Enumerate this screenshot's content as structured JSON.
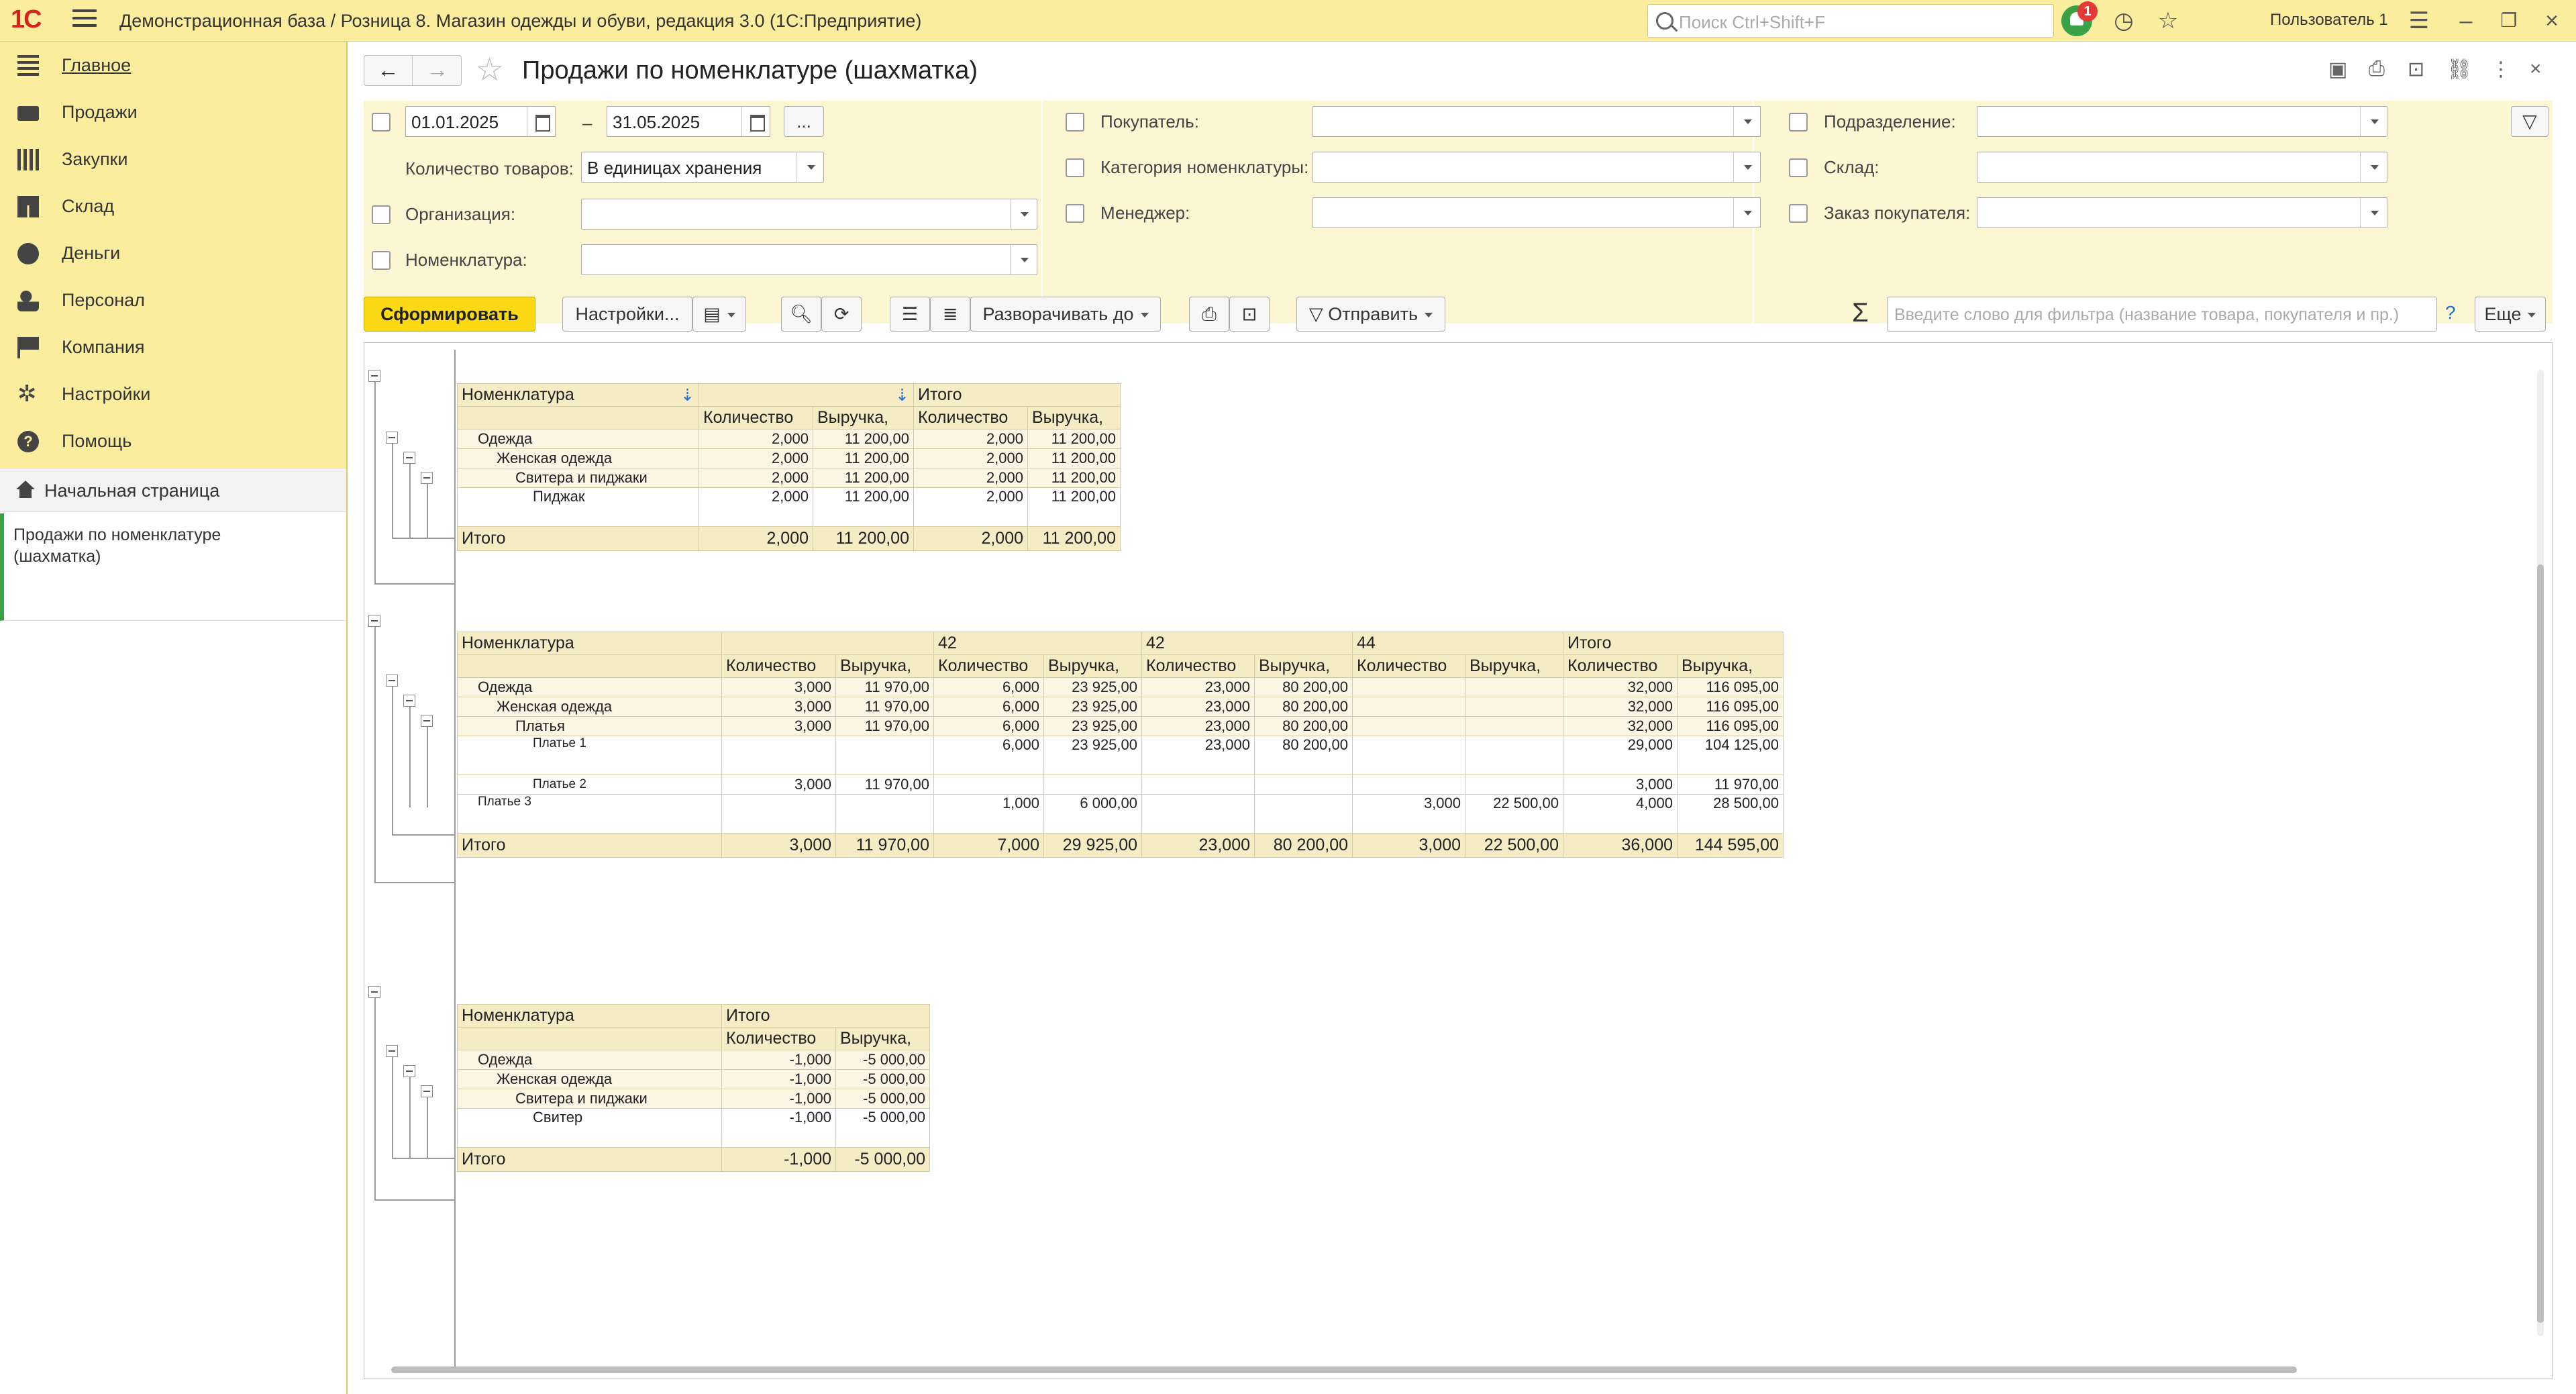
{
  "topbar": {
    "logo": "1С",
    "title": "Демонстрационная база / Розница 8. Магазин одежды и обуви, редакция 3.0  (1С:Предприятие)",
    "search_placeholder": "Поиск Ctrl+Shift+F",
    "notifications_count": "1",
    "user": "Пользователь 1"
  },
  "sidebar": {
    "items": [
      {
        "label": "Главное",
        "icon": "list-icon"
      },
      {
        "label": "Продажи",
        "icon": "cart-icon"
      },
      {
        "label": "Закупки",
        "icon": "purchase-icon"
      },
      {
        "label": "Склад",
        "icon": "warehouse-icon"
      },
      {
        "label": "Деньги",
        "icon": "money-icon"
      },
      {
        "label": "Персонал",
        "icon": "people-icon"
      },
      {
        "label": "Компания",
        "icon": "flag-icon"
      },
      {
        "label": "Настройки",
        "icon": "gear-icon"
      },
      {
        "label": "Помощь",
        "icon": "help-icon"
      }
    ],
    "home_label": "Начальная страница",
    "opened_form": "Продажи по номенклатуре (шахматка)"
  },
  "form": {
    "title": "Продажи по номенклатуре (шахматка)",
    "filters": {
      "date_from": "01.01.2025",
      "date_sep": "–",
      "date_to": "31.05.2025",
      "period_button": "...",
      "qty_label": "Количество товаров:",
      "qty_value": "В единицах хранения",
      "org_label": "Организация:",
      "nom_label": "Номенклатура:",
      "buyer_label": "Покупатель:",
      "category_label": "Категория номенклатуры:",
      "manager_label": "Менеджер:",
      "division_label": "Подразделение:",
      "warehouse_label": "Склад:",
      "order_label": "Заказ покупателя:"
    },
    "toolbar": {
      "generate": "Сформировать",
      "settings": "Настройки...",
      "expand_to": "Разворачивать до",
      "send": "Отправить",
      "filter_placeholder": "Введите слово для фильтра (название товара, покупателя и пр.)",
      "help": "?",
      "more": "Еще",
      "sigma": "Σ"
    }
  },
  "report": {
    "t1": {
      "h_nom": "Номенклатура",
      "h_total": "Итого",
      "h_qty": "Количество",
      "h_rev": "Выручка,",
      "rows": [
        {
          "name": "Одежда",
          "q": "2,000",
          "r": "11 200,00",
          "tq": "2,000",
          "tr": "11 200,00"
        },
        {
          "name": "Женская одежда",
          "q": "2,000",
          "r": "11 200,00",
          "tq": "2,000",
          "tr": "11 200,00"
        },
        {
          "name": "Свитера и пиджаки",
          "q": "2,000",
          "r": "11 200,00",
          "tq": "2,000",
          "tr": "11 200,00"
        },
        {
          "name": "Пиджак",
          "q": "2,000",
          "r": "11 200,00",
          "tq": "2,000",
          "tr": "11 200,00"
        }
      ],
      "total": {
        "name": "Итого",
        "q": "2,000",
        "r": "11 200,00",
        "tq": "2,000",
        "tr": "11 200,00"
      }
    },
    "t2": {
      "h_nom": "Номенклатура",
      "h_col1": "42",
      "h_col2": "42",
      "h_col3": "44",
      "h_total": "Итого",
      "h_qty": "Количество",
      "h_rev": "Выручка,",
      "rows": [
        {
          "name": "Одежда",
          "c0q": "3,000",
          "c0r": "11 970,00",
          "c1q": "6,000",
          "c1r": "23 925,00",
          "c2q": "23,000",
          "c2r": "80 200,00",
          "c3q": "",
          "c3r": "",
          "tq": "32,000",
          "tr": "116 095,00"
        },
        {
          "name": "Женская одежда",
          "c0q": "3,000",
          "c0r": "11 970,00",
          "c1q": "6,000",
          "c1r": "23 925,00",
          "c2q": "23,000",
          "c2r": "80 200,00",
          "c3q": "",
          "c3r": "",
          "tq": "32,000",
          "tr": "116 095,00"
        },
        {
          "name": "Платья",
          "c0q": "3,000",
          "c0r": "11 970,00",
          "c1q": "6,000",
          "c1r": "23 925,00",
          "c2q": "23,000",
          "c2r": "80 200,00",
          "c3q": "",
          "c3r": "",
          "tq": "32,000",
          "tr": "116 095,00"
        },
        {
          "name": "Платье 1",
          "c0q": "",
          "c0r": "",
          "c1q": "6,000",
          "c1r": "23 925,00",
          "c2q": "23,000",
          "c2r": "80 200,00",
          "c3q": "",
          "c3r": "",
          "tq": "29,000",
          "tr": "104 125,00"
        },
        {
          "name": "Платье 2",
          "c0q": "3,000",
          "c0r": "11 970,00",
          "c1q": "",
          "c1r": "",
          "c2q": "",
          "c2r": "",
          "c3q": "",
          "c3r": "",
          "tq": "3,000",
          "tr": "11 970,00"
        },
        {
          "name": "Платье 3",
          "c0q": "",
          "c0r": "",
          "c1q": "1,000",
          "c1r": "6 000,00",
          "c2q": "",
          "c2r": "",
          "c3q": "3,000",
          "c3r": "22 500,00",
          "tq": "4,000",
          "tr": "28 500,00"
        }
      ],
      "total": {
        "name": "Итого",
        "c0q": "3,000",
        "c0r": "11 970,00",
        "c1q": "7,000",
        "c1r": "29 925,00",
        "c2q": "23,000",
        "c2r": "80 200,00",
        "c3q": "3,000",
        "c3r": "22 500,00",
        "tq": "36,000",
        "tr": "144 595,00"
      }
    },
    "t3": {
      "h_nom": "Номенклатура",
      "h_total": "Итого",
      "h_qty": "Количество",
      "h_rev": "Выручка,",
      "rows": [
        {
          "name": "Одежда",
          "tq": "-1,000",
          "tr": "-5 000,00"
        },
        {
          "name": "Женская одежда",
          "tq": "-1,000",
          "tr": "-5 000,00"
        },
        {
          "name": "Свитера и пиджаки",
          "tq": "-1,000",
          "tr": "-5 000,00"
        },
        {
          "name": "Свитер",
          "tq": "-1,000",
          "tr": "-5 000,00"
        }
      ],
      "total": {
        "name": "Итого",
        "tq": "-1,000",
        "tr": "-5 000,00"
      }
    }
  }
}
